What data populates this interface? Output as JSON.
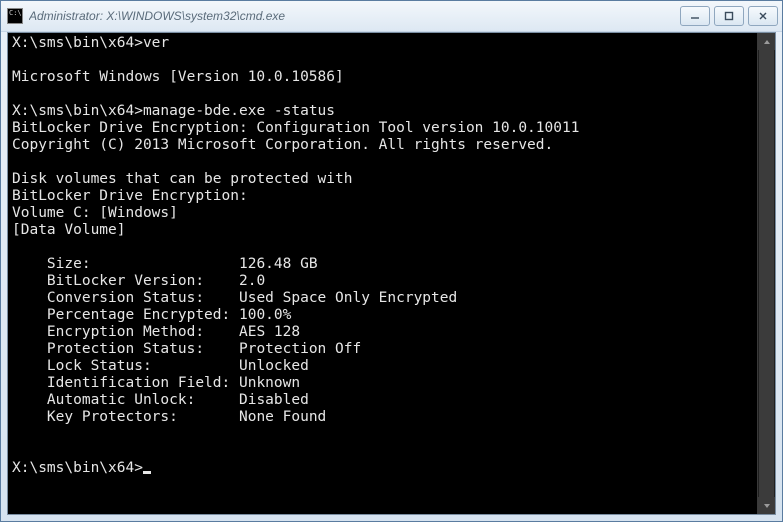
{
  "window": {
    "title": "Administrator: X:\\WINDOWS\\system32\\cmd.exe"
  },
  "prompt": "X:\\sms\\bin\\x64>",
  "cmd1": "ver",
  "ver_output": "Microsoft Windows [Version 10.0.10586]",
  "cmd2": "manage-bde.exe -status",
  "bde": {
    "header1": "BitLocker Drive Encryption: Configuration Tool version 10.0.10011",
    "header2": "Copyright (C) 2013 Microsoft Corporation. All rights reserved.",
    "intro1": "Disk volumes that can be protected with",
    "intro2": "BitLocker Drive Encryption:",
    "volume_line": "Volume C: [Windows]",
    "volume_type": "[Data Volume]",
    "fields": {
      "size": {
        "k": "Size:",
        "v": "126.48 GB"
      },
      "version": {
        "k": "BitLocker Version:",
        "v": "2.0"
      },
      "conversion": {
        "k": "Conversion Status:",
        "v": "Used Space Only Encrypted"
      },
      "percent": {
        "k": "Percentage Encrypted:",
        "v": "100.0%"
      },
      "method": {
        "k": "Encryption Method:",
        "v": "AES 128"
      },
      "protection": {
        "k": "Protection Status:",
        "v": "Protection Off"
      },
      "lock": {
        "k": "Lock Status:",
        "v": "Unlocked"
      },
      "idfield": {
        "k": "Identification Field:",
        "v": "Unknown"
      },
      "autounlock": {
        "k": "Automatic Unlock:",
        "v": "Disabled"
      },
      "protectors": {
        "k": "Key Protectors:",
        "v": "None Found"
      }
    }
  }
}
